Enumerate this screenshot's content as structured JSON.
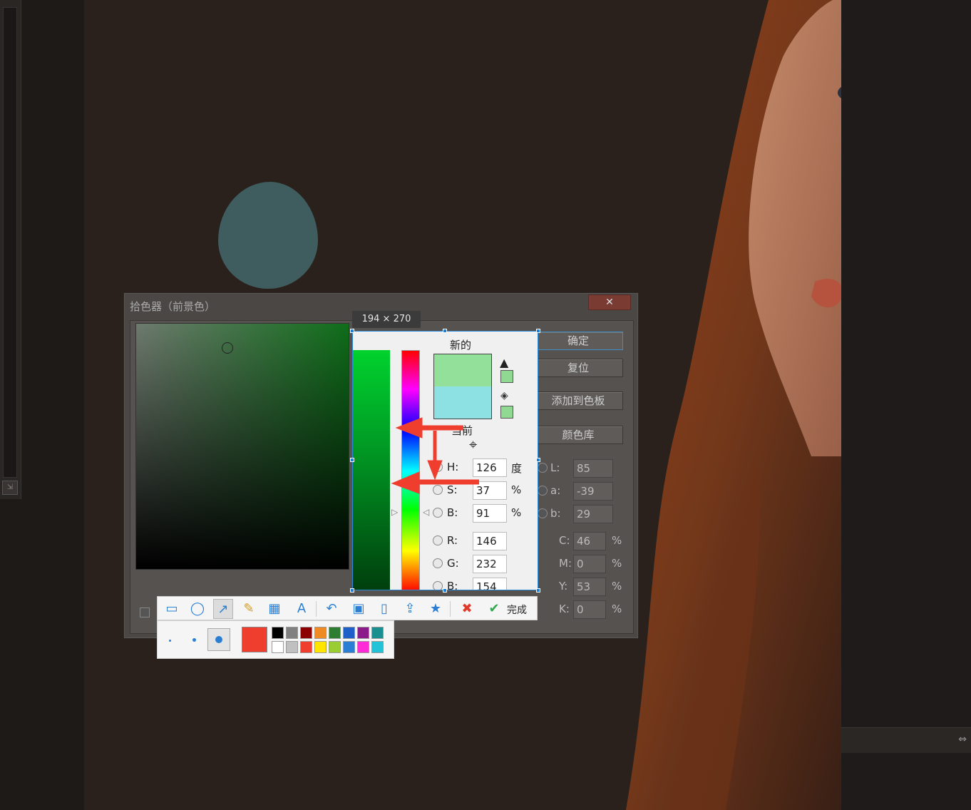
{
  "dialog": {
    "title": "拾色器（前景色）",
    "close_label": "✕",
    "buttons": {
      "ok": "确定",
      "reset": "复位",
      "add_swatch": "添加到色板",
      "color_library": "颜色库"
    },
    "lab": [
      {
        "label": "L:",
        "value": "85",
        "unit": ""
      },
      {
        "label": "a:",
        "value": "-39",
        "unit": ""
      },
      {
        "label": "b:",
        "value": "29",
        "unit": ""
      }
    ],
    "cmyk": [
      {
        "label": "C:",
        "value": "46",
        "unit": "%"
      },
      {
        "label": "M:",
        "value": "0",
        "unit": "%"
      },
      {
        "label": "Y:",
        "value": "53",
        "unit": "%"
      },
      {
        "label": "K:",
        "value": "0",
        "unit": "%"
      }
    ]
  },
  "capture": {
    "size_tip": "194 × 270",
    "new_label": "新的",
    "current_label": "当前",
    "new_color": "#92e09a",
    "current_color": "#8ee1e3",
    "hsb": [
      {
        "label": "H:",
        "value": "126",
        "unit": "度"
      },
      {
        "label": "S:",
        "value": "37",
        "unit": "%"
      },
      {
        "label": "B:",
        "value": "91",
        "unit": "%"
      }
    ],
    "rgb": [
      {
        "label": "R:",
        "value": "146"
      },
      {
        "label": "G:",
        "value": "232"
      },
      {
        "label": "B:",
        "value": "154"
      }
    ]
  },
  "toolbar": {
    "done_label": "完成",
    "tools": [
      "rectangle-icon",
      "ellipse-icon",
      "arrow-icon",
      "pen-icon",
      "mosaic-icon",
      "text-icon",
      "undo-icon",
      "save-icon",
      "pin-icon",
      "share-icon",
      "bookmark-icon",
      "cancel-icon",
      "check-icon"
    ]
  },
  "palette": {
    "current": "#ef3e2e",
    "top_row": [
      "#000000",
      "#808080",
      "#8b0000",
      "#f08a24",
      "#2e7d32",
      "#1e60c8",
      "#8b1a8b",
      "#1a8f8f"
    ],
    "bottom_row": [
      "#ffffff",
      "#c0c0c0",
      "#ef3e2e",
      "#ffe500",
      "#9acd32",
      "#2a7fd4",
      "#ff2bd6",
      "#22c3d6"
    ]
  }
}
